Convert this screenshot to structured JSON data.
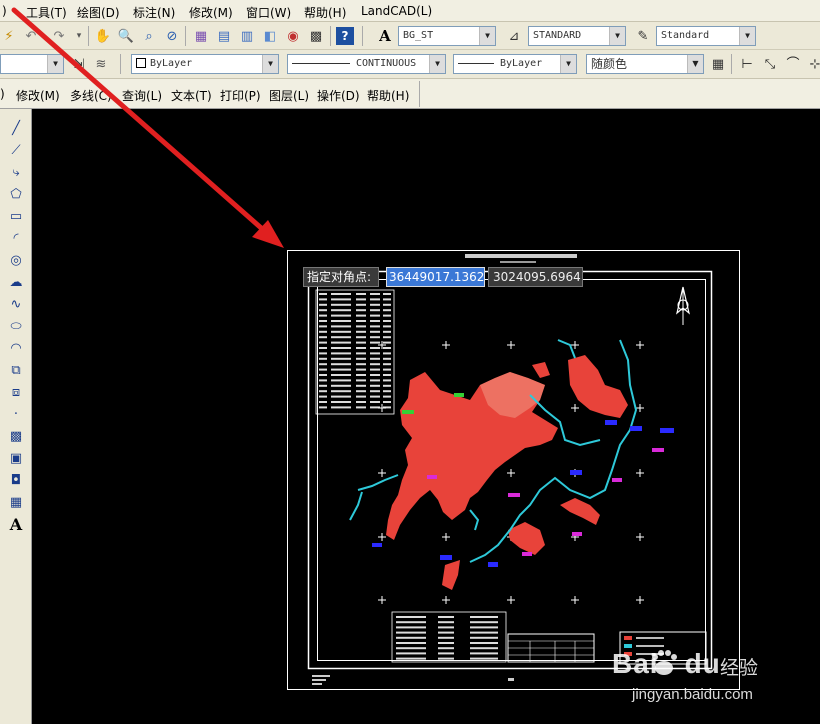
{
  "menubar": {
    "items": [
      ")",
      "工具(T)",
      "绘图(D)",
      "标注(N)",
      "修改(M)",
      "窗口(W)",
      "帮助(H)",
      "LandCAD(L)"
    ]
  },
  "toolbar_styles": {
    "text_style": "BG_ST",
    "dim_style": "STANDARD",
    "table_style": "Standard"
  },
  "properties_bar": {
    "layer": "ByLayer",
    "linetype": "CONTINUOUS",
    "lineweight": "ByLayer",
    "color": "随颜色"
  },
  "secondary_menu": {
    "items": [
      ")",
      "修改(M)",
      "多线(C)",
      "查询(L)",
      "文本(T)",
      "打印(P)",
      "图层(L)",
      "操作(D)",
      "帮助(H)"
    ]
  },
  "left_toolbar": {
    "text_tool": "A",
    "tools": [
      "line-tool-icon",
      "construction-line-icon",
      "polyline-icon",
      "polygon-icon",
      "rectangle-icon",
      "arc-icon",
      "circle-icon",
      "revision-cloud-icon",
      "spline-icon",
      "ellipse-icon",
      "ellipse-arc-icon",
      "insert-block-icon",
      "make-block-icon",
      "point-icon",
      "hatch-icon",
      "gradient-icon",
      "region-icon",
      "table-icon",
      "mtext-icon"
    ]
  },
  "dynamic_input": {
    "prompt": "指定对角点:",
    "x_value": "36449017.1362",
    "y_value": "3024095.6964"
  },
  "watermark": {
    "logo": "Bai",
    "logo2": "du",
    "cn": "经验",
    "url": "jingyan.baidu.com"
  },
  "colors": {
    "canvas": "#000000",
    "annotation_arrow": "#e02020",
    "map_fill": "#e8433a",
    "rivers": "#2ec9d9",
    "labels_blue": "#2a2aff",
    "labels_magenta": "#d92ad9"
  }
}
